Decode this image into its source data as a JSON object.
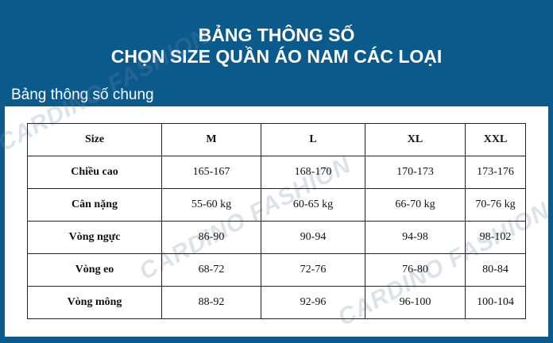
{
  "header": {
    "title_line1": "BẢNG THÔNG SỐ",
    "title_line2": "CHỌN SIZE QUẦN ÁO NAM CÁC LOẠI"
  },
  "section_label": "Bảng thông số chung",
  "watermark": "CARDINO FASHION",
  "colors": {
    "background": "#0b5a8c",
    "panel": "#ffffff",
    "text": "#111111"
  },
  "table": {
    "headers": [
      "Size",
      "M",
      "L",
      "XL",
      "XXL"
    ],
    "rows": [
      [
        "Chiều cao",
        "165-167",
        "168-170",
        "170-173",
        "173-176"
      ],
      [
        "Cân nặng",
        "55-60 kg",
        "60-65 kg",
        "66-70 kg",
        "70-76 kg"
      ],
      [
        "Vòng ngực",
        "86-90",
        "90-94",
        "94-98",
        "98-102"
      ],
      [
        "Vòng eo",
        "68-72",
        "72-76",
        "76-80",
        "80-84"
      ],
      [
        "Vòng mông",
        "88-92",
        "92-96",
        "96-100",
        "100-104"
      ]
    ]
  }
}
